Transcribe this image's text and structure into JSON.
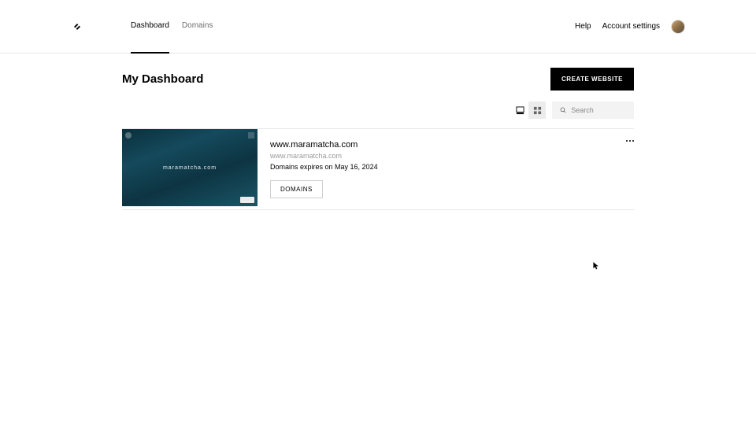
{
  "nav": {
    "tabs": [
      {
        "label": "Dashboard",
        "active": true
      },
      {
        "label": "Domains",
        "active": false
      }
    ],
    "help": "Help",
    "account_settings": "Account settings"
  },
  "page": {
    "title": "My Dashboard",
    "create_button": "CREATE WEBSITE"
  },
  "toolbar": {
    "search_placeholder": "Search"
  },
  "sites": [
    {
      "title": "www.maramatcha.com",
      "url": "www.maramatcha.com",
      "expires": "Domains expires on May 16, 2024",
      "thumbnail_text": "maramatcha.com",
      "domains_button": "DOMAINS"
    }
  ]
}
